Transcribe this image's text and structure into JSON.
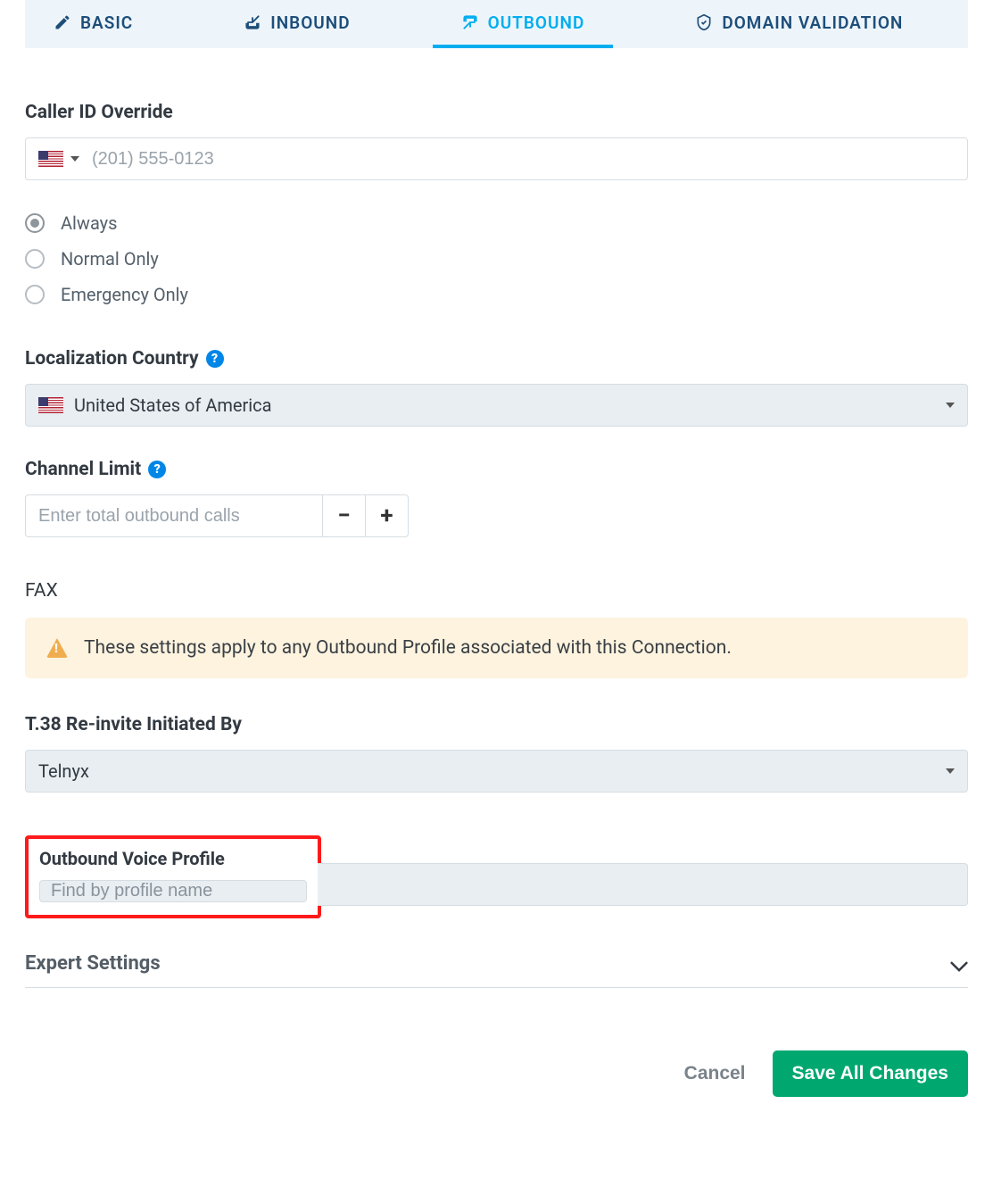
{
  "tabs": {
    "basic": "BASIC",
    "inbound": "INBOUND",
    "outbound": "OUTBOUND",
    "domain_validation": "DOMAIN VALIDATION",
    "active": "outbound"
  },
  "caller_id": {
    "label": "Caller ID Override",
    "placeholder": "(201) 555-0123",
    "value": ""
  },
  "caller_id_mode": {
    "options": {
      "always": "Always",
      "normal": "Normal Only",
      "emergency": "Emergency Only"
    },
    "selected": "always"
  },
  "localization": {
    "label": "Localization Country",
    "selected": "United States of America"
  },
  "channel_limit": {
    "label": "Channel Limit",
    "placeholder": "Enter total outbound calls",
    "value": ""
  },
  "fax": {
    "heading": "FAX",
    "alert": "These settings apply to any Outbound Profile associated with this Connection."
  },
  "t38": {
    "label": "T.38 Re-invite Initiated By",
    "selected": "Telnyx"
  },
  "outbound_profile": {
    "label": "Outbound Voice Profile",
    "placeholder": "Find by profile name",
    "value": ""
  },
  "expert": {
    "label": "Expert Settings"
  },
  "actions": {
    "cancel": "Cancel",
    "save": "Save All Changes"
  }
}
